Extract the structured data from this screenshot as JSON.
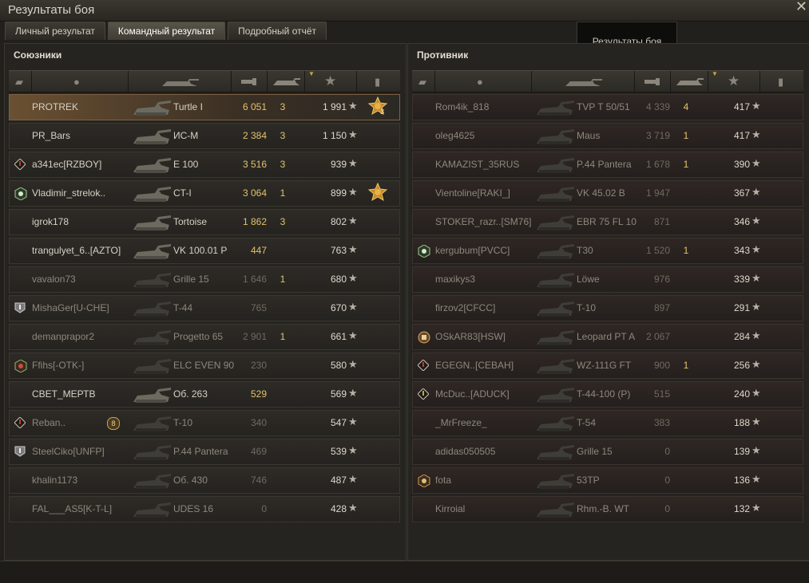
{
  "window": {
    "title": "Результаты боя",
    "close": "✕"
  },
  "tabs": [
    {
      "label": "Личный результат",
      "active": false
    },
    {
      "label": "Командный результат",
      "active": true
    },
    {
      "label": "Подробный отчёт",
      "active": false
    }
  ],
  "tooltip": "Результаты боя",
  "allies": {
    "title": "Союзники",
    "rows": [
      {
        "name": "PROTREK",
        "badge": "",
        "vehicle": "Turtle I",
        "damage": "6 051",
        "kills": "3",
        "xp": "1 991",
        "medal": "3",
        "me": true,
        "dead": false
      },
      {
        "name": "PR_Bars",
        "badge": "",
        "vehicle": "ИС-М",
        "damage": "2 384",
        "kills": "3",
        "xp": "1 150",
        "medal": "",
        "dead": false
      },
      {
        "name": "a341ec[RZBOY]",
        "badge": "diamond",
        "vehicle": "E 100",
        "damage": "3 516",
        "kills": "3",
        "xp": "939",
        "medal": "",
        "dead": false
      },
      {
        "name": "Vladimir_strelok..",
        "badge": "hex",
        "vehicle": "CT-I",
        "damage": "3 064",
        "kills": "1",
        "xp": "899",
        "medal": "1",
        "dead": false
      },
      {
        "name": "igrok178",
        "badge": "",
        "vehicle": "Tortoise",
        "damage": "1 862",
        "kills": "3",
        "xp": "802",
        "medal": "",
        "dead": false
      },
      {
        "name": "trangulyet_6..[AZTO]",
        "badge": "",
        "vehicle": "VK 100.01 P",
        "damage": "447",
        "kills": "",
        "xp": "763",
        "medal": "",
        "dead": false
      },
      {
        "name": "vavalon73",
        "badge": "",
        "vehicle": "Grille 15",
        "damage": "1 646",
        "kills": "1",
        "xp": "680",
        "medal": "",
        "dead": true
      },
      {
        "name": "MishaGer[U-CHE]",
        "badge": "shield",
        "vehicle": "T-44",
        "damage": "765",
        "kills": "",
        "xp": "670",
        "medal": "",
        "dead": true
      },
      {
        "name": "demanprapor2",
        "badge": "",
        "vehicle": "Progetto 65",
        "damage": "2 901",
        "kills": "1",
        "xp": "661",
        "medal": "",
        "dead": true
      },
      {
        "name": "Ffihs[-OTK-]",
        "badge": "hexred",
        "vehicle": "ELC EVEN 90",
        "damage": "230",
        "kills": "",
        "xp": "580",
        "medal": "",
        "dead": true
      },
      {
        "name": "СВЕТ_МЕРТВ",
        "badge": "",
        "vehicle": "Об. 263",
        "damage": "529",
        "kills": "",
        "xp": "569",
        "medal": "",
        "dead": false
      },
      {
        "name": "Reban..",
        "badge": "diamond",
        "vehicle": "T-10",
        "damage": "340",
        "kills": "",
        "xp": "547",
        "medal": "",
        "platoon": "8",
        "dead": true
      },
      {
        "name": "SteelCiko[UNFP]",
        "badge": "shield",
        "vehicle": "P.44 Pantera",
        "damage": "469",
        "kills": "",
        "xp": "539",
        "medal": "",
        "dead": true
      },
      {
        "name": "khalin1173",
        "badge": "",
        "vehicle": "Об. 430",
        "damage": "746",
        "kills": "",
        "xp": "487",
        "medal": "",
        "dead": true
      },
      {
        "name": "FAL___AS5[K-T-L]",
        "badge": "",
        "vehicle": "UDES 16",
        "damage": "0",
        "kills": "",
        "xp": "428",
        "medal": "",
        "dead": true
      }
    ]
  },
  "enemies": {
    "title": "Противник",
    "rows": [
      {
        "name": "Rom4ik_818",
        "badge": "",
        "vehicle": "TVP T 50/51",
        "damage": "4 339",
        "kills": "4",
        "xp": "417",
        "dead": true
      },
      {
        "name": "oleg4625",
        "badge": "",
        "vehicle": "Maus",
        "damage": "3 719",
        "kills": "1",
        "xp": "417",
        "dead": true
      },
      {
        "name": "KAMAZIST_35RUS",
        "badge": "",
        "vehicle": "P.44 Pantera",
        "damage": "1 678",
        "kills": "1",
        "xp": "390",
        "dead": true
      },
      {
        "name": "Vientoline[RAKI_]",
        "badge": "",
        "vehicle": "VK 45.02 B",
        "damage": "1 947",
        "kills": "",
        "xp": "367",
        "dead": true
      },
      {
        "name": "STOKER_razr..[SM76]",
        "badge": "",
        "vehicle": "EBR 75 FL 10",
        "damage": "871",
        "kills": "",
        "xp": "346",
        "dead": true
      },
      {
        "name": "kergubum[PVCC]",
        "badge": "hex",
        "vehicle": "T30",
        "damage": "1 520",
        "kills": "1",
        "xp": "343",
        "dead": true
      },
      {
        "name": "maxikys3",
        "badge": "",
        "vehicle": "Löwe",
        "damage": "976",
        "kills": "",
        "xp": "339",
        "dead": true
      },
      {
        "name": "firzov2[CFCC]",
        "badge": "",
        "vehicle": "T-10",
        "damage": "897",
        "kills": "",
        "xp": "291",
        "dead": true
      },
      {
        "name": "OSkAR83[HSW]",
        "badge": "emblem",
        "vehicle": "Leopard PT A",
        "damage": "2 067",
        "kills": "",
        "xp": "284",
        "dead": true
      },
      {
        "name": "EGEGN..[CEBAH]",
        "badge": "diamond",
        "vehicle": "WZ-111G FT",
        "damage": "900",
        "kills": "1",
        "xp": "256",
        "dead": true
      },
      {
        "name": "McDuc..[ADUCK]",
        "badge": "diamond2",
        "vehicle": "T-44-100 (P)",
        "damage": "515",
        "kills": "",
        "xp": "240",
        "dead": true
      },
      {
        "name": "_MrFreeze_",
        "badge": "",
        "vehicle": "T-54",
        "damage": "383",
        "kills": "",
        "xp": "188",
        "dead": true
      },
      {
        "name": "adidas050505",
        "badge": "",
        "vehicle": "Grille 15",
        "damage": "0",
        "kills": "",
        "xp": "139",
        "dead": true
      },
      {
        "name": "fota",
        "badge": "hexorange",
        "vehicle": "53TP",
        "damage": "0",
        "kills": "",
        "xp": "136",
        "dead": true
      },
      {
        "name": "Kirroial",
        "badge": "",
        "vehicle": "Rhm.-B. WT",
        "damage": "0",
        "kills": "",
        "xp": "132",
        "dead": true
      }
    ]
  },
  "header_icons": [
    "platoon-icon",
    "player-icon",
    "vehicle-icon",
    "damage-icon",
    "kills-icon",
    "xp-star-icon",
    "medal-icon"
  ],
  "colors": {
    "accent_gold": "#e3c26c",
    "me_row": "#6a5032",
    "bg": "#22201c"
  }
}
